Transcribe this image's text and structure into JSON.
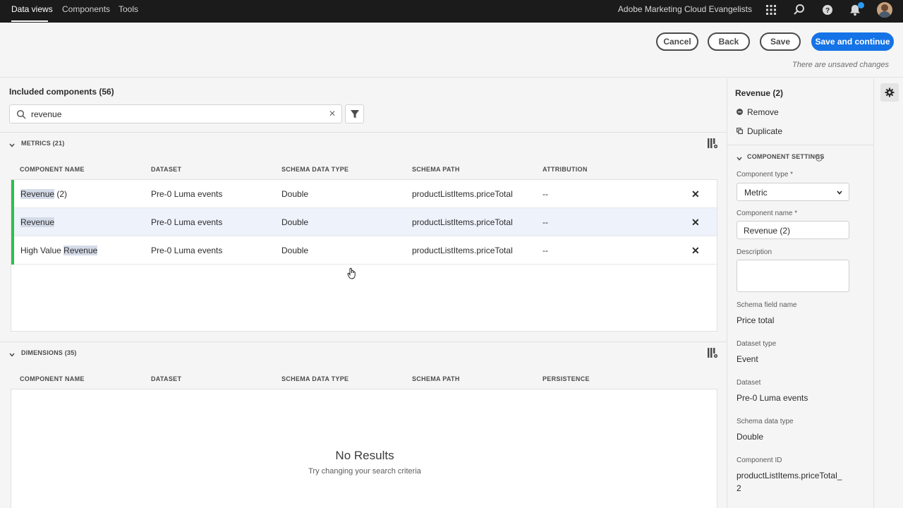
{
  "topnav": {
    "tabs": [
      {
        "label": "Data views",
        "active": true
      },
      {
        "label": "Components",
        "active": false
      },
      {
        "label": "Tools",
        "active": false
      }
    ],
    "org_name": "Adobe Marketing Cloud Evangelists",
    "icons": [
      "apps-grid-icon",
      "search-icon",
      "help-icon",
      "bell-icon",
      "user-avatar"
    ]
  },
  "actions": {
    "cancel": "Cancel",
    "back": "Back",
    "save": "Save",
    "save_continue": "Save and continue",
    "unsaved_note": "There are unsaved changes"
  },
  "included": {
    "title": "Included components (56)",
    "search_value": "revenue"
  },
  "metrics": {
    "label": "METRICS (21)",
    "columns": [
      "COMPONENT NAME",
      "DATASET",
      "SCHEMA DATA TYPE",
      "SCHEMA PATH",
      "ATTRIBUTION"
    ],
    "rows": [
      {
        "name_hl": "Revenue",
        "name_rest": " (2)",
        "dataset": "Pre-0 Luma events",
        "type": "Double",
        "path": "productListItems.priceTotal",
        "attribution": "--",
        "selected": false
      },
      {
        "name_hl": "Revenue",
        "name_rest": "",
        "dataset": "Pre-0 Luma events",
        "type": "Double",
        "path": "productListItems.priceTotal",
        "attribution": "--",
        "selected": true
      },
      {
        "name_pre": "High Value ",
        "name_hl": "Revenue",
        "dataset": "Pre-0 Luma events",
        "type": "Double",
        "path": "productListItems.priceTotal",
        "attribution": "--",
        "selected": false
      }
    ]
  },
  "dimensions": {
    "label": "DIMENSIONS (35)",
    "columns": [
      "COMPONENT NAME",
      "DATASET",
      "SCHEMA DATA TYPE",
      "SCHEMA PATH",
      "PERSISTENCE"
    ],
    "empty_title": "No Results",
    "empty_sub": "Try changing your search criteria"
  },
  "panel": {
    "title": "Revenue (2)",
    "remove": "Remove",
    "duplicate": "Duplicate",
    "settings_label": "COMPONENT SETTINGS",
    "type_label": "Component type",
    "type_value": "Metric",
    "name_label": "Component name",
    "name_value": "Revenue (2)",
    "desc_label": "Description",
    "schema_field_label": "Schema field name",
    "schema_field_value": "Price total",
    "dataset_type_label": "Dataset type",
    "dataset_type_value": "Event",
    "dataset_label": "Dataset",
    "dataset_value": "Pre-0 Luma events",
    "schema_type_label": "Schema data type",
    "schema_type_value": "Double",
    "component_id_label": "Component ID",
    "component_id_line1": "productListItems.priceTotal_",
    "component_id_line2": "2",
    "required_mark": "*"
  }
}
